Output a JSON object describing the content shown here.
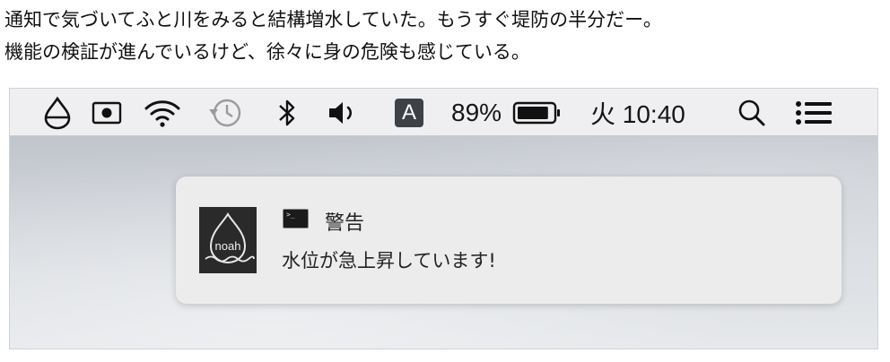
{
  "article": {
    "line1": "通知で気づいてふと川をみると結構増水していた。もうすぐ堤防の半分だー。",
    "line2": "機能の検証が進んでいるけど、徐々に身の危険も感じている。"
  },
  "menubar": {
    "icons": [
      "drop-status-icon",
      "record-icon",
      "wifi-icon",
      "time-machine-icon",
      "bluetooth-icon",
      "volume-icon",
      "input-source-icon",
      "battery-icon",
      "search-icon",
      "notification-center-icon"
    ],
    "input_source_label": "A",
    "battery_percent": "89%",
    "battery_level": 0.89,
    "clock": "火 10:40"
  },
  "notification": {
    "app_icon_label": "noah",
    "title": "警告",
    "body": "水位が急上昇しています!"
  }
}
